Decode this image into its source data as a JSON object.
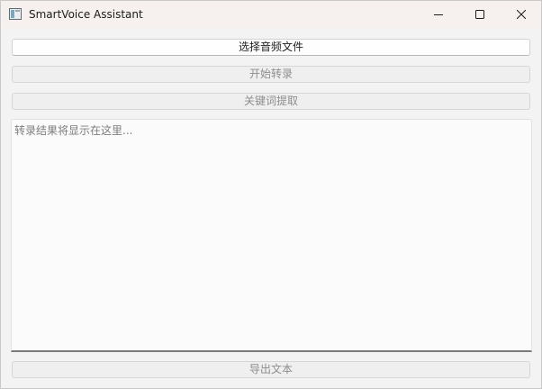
{
  "window": {
    "title": "SmartVoice Assistant",
    "controls": {
      "minimize_icon": "minimize-icon",
      "maximize_icon": "maximize-icon",
      "close_icon": "close-icon"
    }
  },
  "actions": {
    "select_audio": "选择音频文件",
    "start_transcribe": "开始转录",
    "extract_keywords": "关键词提取",
    "export_text": "导出文本"
  },
  "transcript": {
    "placeholder": "转录结果将显示在这里..."
  },
  "colors": {
    "window_bg": "#f3f3f3",
    "titlebar_bg": "#f6f1ee",
    "enabled_text": "#1e1e1e",
    "disabled_text": "#8d8d8d",
    "focus_line": "#7a7a7a"
  }
}
